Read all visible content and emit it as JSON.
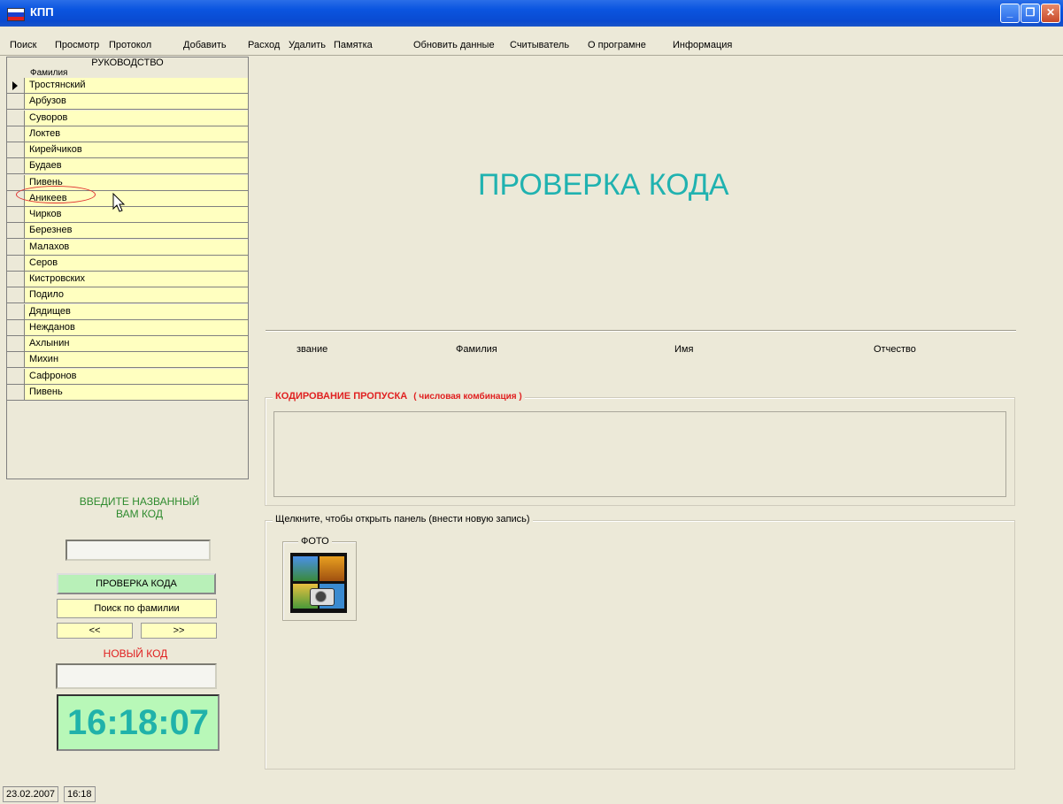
{
  "window": {
    "title": "КПП"
  },
  "menu": [
    "Поиск",
    "Просмотр",
    "Протокол",
    "Добавить",
    "Расход",
    "Удалить",
    "Памятка",
    "Обновить данные",
    "Считыватель",
    "О програмне",
    "Информация"
  ],
  "grid": {
    "caption": "РУКОВОДСТВО",
    "column": "Фамилия",
    "rows": [
      "Тростянский",
      "Арбузов",
      "Суворов",
      "Локтев",
      "Кирейчиков",
      "Будаев",
      "Пивень",
      "Аникеев",
      "Чирков",
      "Березнев",
      "Малахов",
      "Серов",
      "Кистровских",
      "Подило",
      "Дядищев",
      "Нежданов",
      "Ахлынин",
      "Михин",
      "Сафронов",
      "Пивень"
    ]
  },
  "left": {
    "prompt_line1": "ВВЕДИТЕ НАЗВАННЫЙ",
    "prompt_line2": "ВАМ КОД",
    "code_value": "",
    "check_button": "ПРОВЕРКА КОДА",
    "search_button": "Поиск по фамилии",
    "prev_button": "<<",
    "next_button": ">>",
    "new_code_label": "НОВЫЙ КОД",
    "new_code_value": "",
    "clock": "16:18:07"
  },
  "main": {
    "title": "ПРОВЕРКА КОДА",
    "columns": [
      "звание",
      "Фамилия",
      "Имя",
      "Отчество"
    ],
    "coding_legend": "КОДИРОВАНИЕ ПРОПУСКА",
    "coding_hint": "( числовая комбинация )",
    "panel_legend": "Щелкните, чтобы открыть панель (внести новую запись)",
    "photo_label": "ФОТО"
  },
  "status": {
    "date": "23.02.2007",
    "time": "16:18"
  },
  "colors": {
    "accent_teal": "#20b2b0",
    "red": "#e02020",
    "green": "#2e8b2e",
    "cell_yellow": "#ffffc0"
  }
}
